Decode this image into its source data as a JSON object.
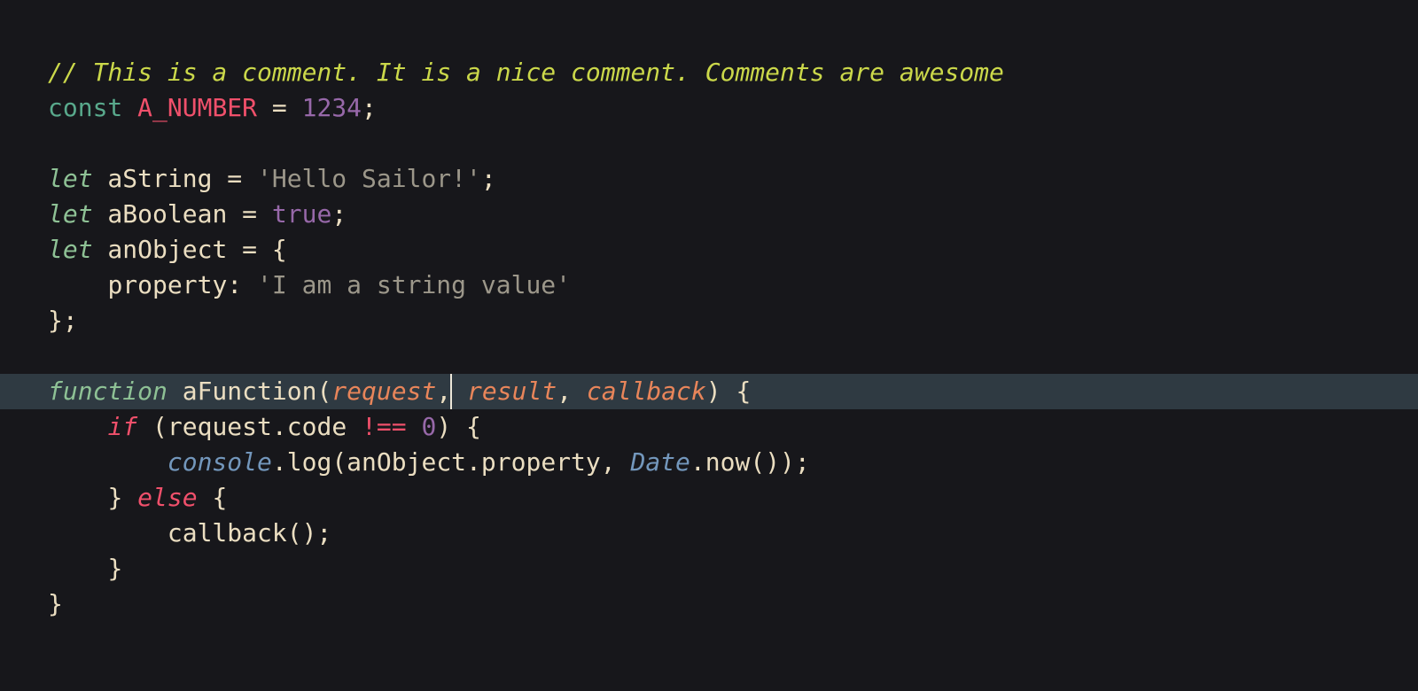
{
  "code": {
    "comment": "// This is a comment. It is a nice comment. Comments are awesome",
    "l2": {
      "kw": "const",
      "name": "A_NUMBER",
      "eq": " = ",
      "val": "1234",
      "semi": ";"
    },
    "l4": {
      "kw": "let",
      "name": " aString",
      "eq": " = ",
      "val": "'Hello Sailor!'",
      "semi": ";"
    },
    "l5": {
      "kw": "let",
      "name": " aBoolean",
      "eq": " = ",
      "val": "true",
      "semi": ";"
    },
    "l6": {
      "kw": "let",
      "name": " anObject",
      "eq": " = ",
      "brace": "{"
    },
    "l7": {
      "indent": "    ",
      "prop": "property",
      "colon": ": ",
      "val": "'I am a string value'"
    },
    "l8": {
      "close": "};"
    },
    "l10": {
      "kw": "function",
      "name": " aFunction",
      "open": "(",
      "p1": "request",
      "c1": ",",
      "p2": " result",
      "c2": ",",
      "p3": " callback",
      "close": ")",
      "brace": " {"
    },
    "l11": {
      "indent": "    ",
      "kw": "if",
      "open": " (",
      "obj": "request",
      "dot": ".",
      "prop": "code",
      "op": " !== ",
      "zero": "0",
      "close": ") {"
    },
    "l12": {
      "indent": "        ",
      "console": "console",
      "dot1": ".",
      "log": "log",
      "open": "(",
      "obj": "anObject",
      "dot2": ".",
      "prop": "property",
      "comma": ", ",
      "date": "Date",
      "dot3": ".",
      "now": "now",
      "call": "());"
    },
    "l13": {
      "indent": "    ",
      "close": "}",
      "kw": " else",
      "brace": " {"
    },
    "l14": {
      "indent": "        ",
      "fn": "callback",
      "call": "();"
    },
    "l15": {
      "indent": "    ",
      "close": "}"
    },
    "l16": {
      "close": "}"
    }
  }
}
